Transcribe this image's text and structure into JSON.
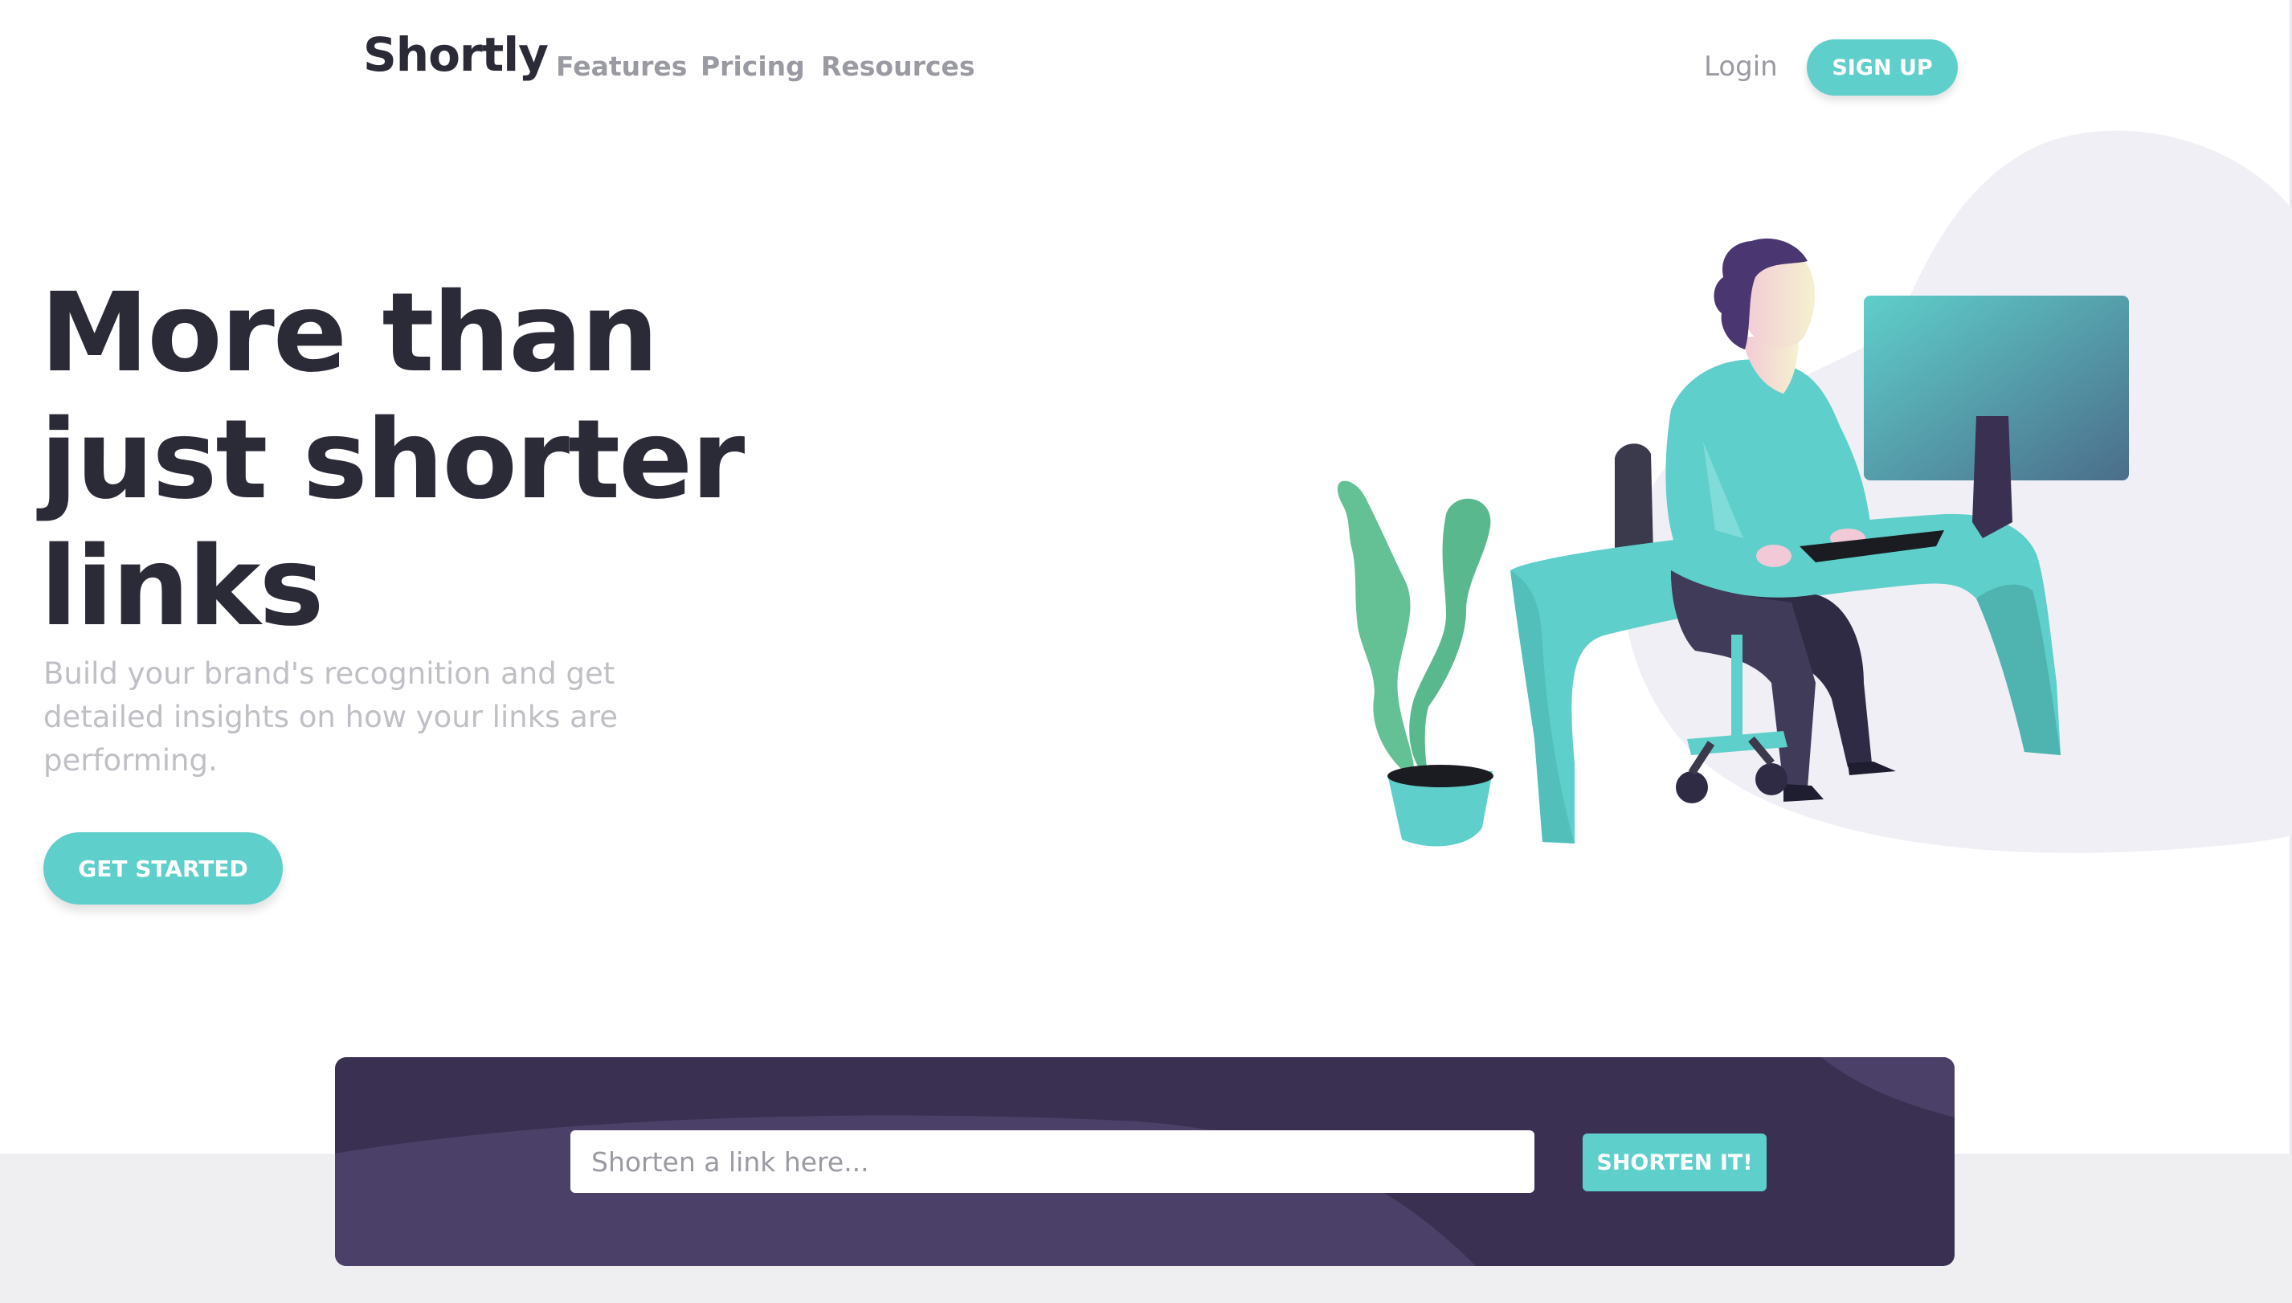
{
  "nav": {
    "logo": "Shortly",
    "links": [
      "Features",
      "Pricing",
      "Resources"
    ],
    "login": "Login",
    "signup": "SIGN UP"
  },
  "hero": {
    "title": "More than just shorter links",
    "subtitle": "Build your brand's recognition and get detailed insights on how your links are performing.",
    "cta": "GET STARTED",
    "illustration": "person-working-at-desk-illustration"
  },
  "shorten": {
    "placeholder": "Shorten a link here...",
    "value": "",
    "button": "SHORTEN IT!"
  },
  "colors": {
    "primary": "#5fcfcb",
    "dark_violet": "#3a3052",
    "heading": "#2b2a37",
    "gray_text": "#9a9aa3"
  }
}
